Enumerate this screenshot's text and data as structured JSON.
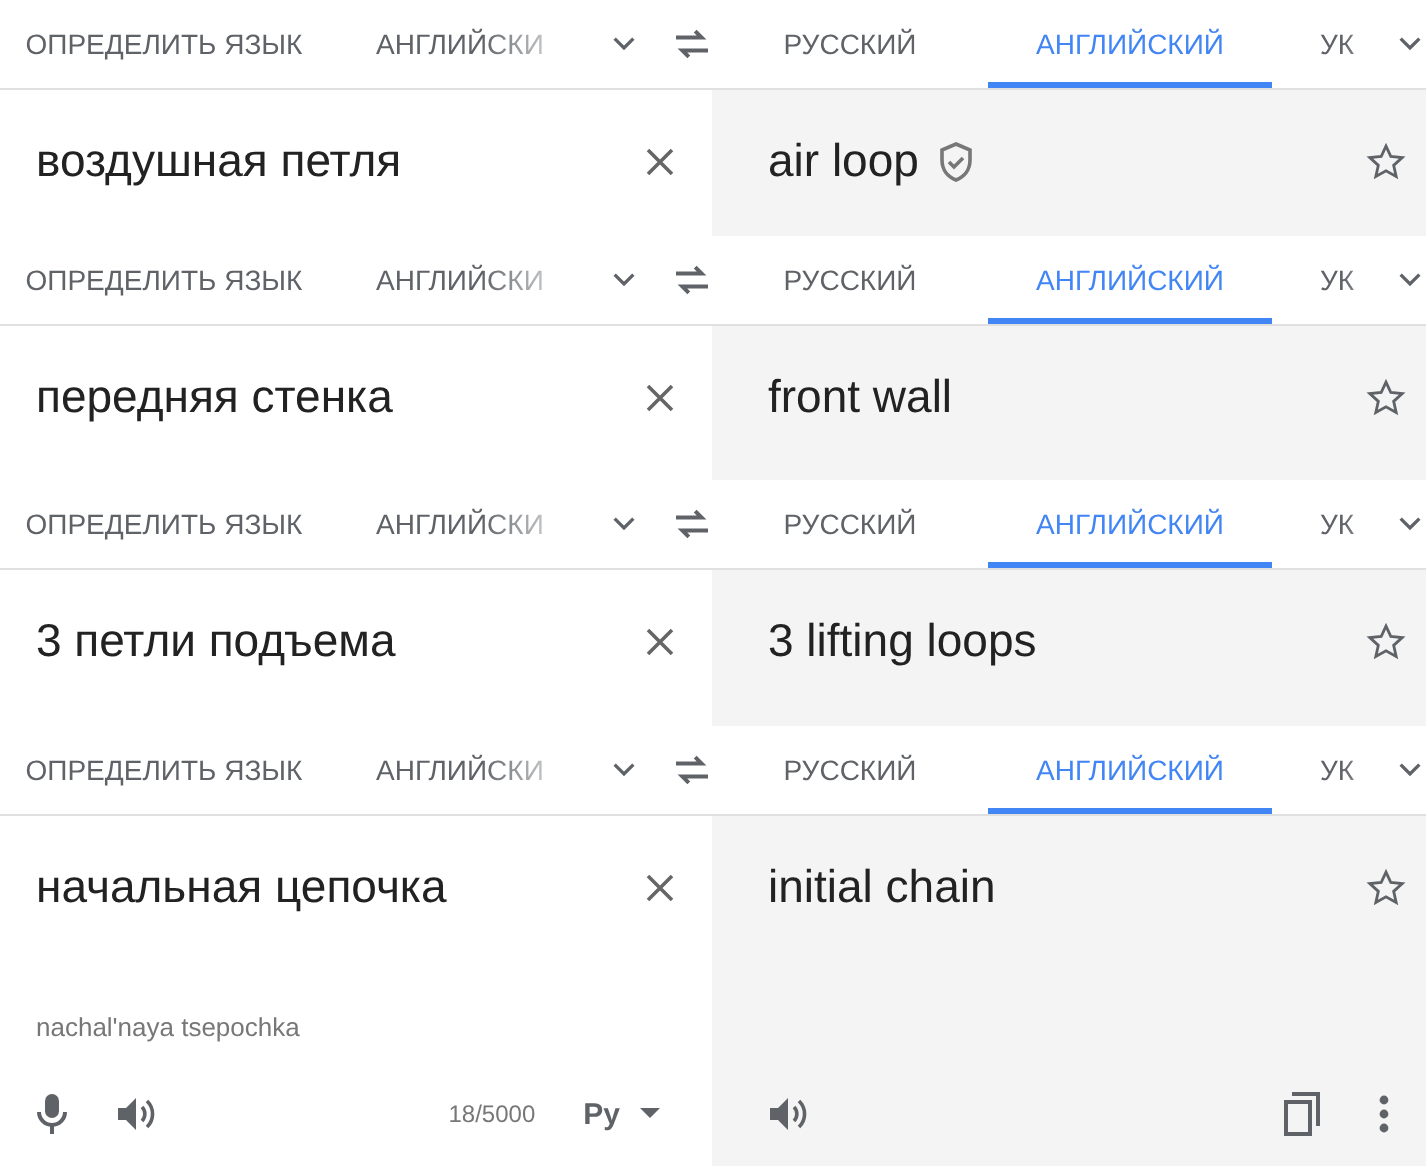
{
  "panels": [
    {
      "source_tabs": [
        {
          "label": "ОПРЕДЕЛИТЬ ЯЗЫК",
          "selected": false,
          "cut": false
        },
        {
          "label": "АНГЛИЙСКИ",
          "selected": false,
          "cut": true
        }
      ],
      "target_tabs": [
        {
          "label": "РУССКИЙ",
          "selected": false,
          "cut": false
        },
        {
          "label": "АНГЛИЙСКИЙ",
          "selected": true,
          "cut": false
        },
        {
          "label": "УК",
          "selected": false,
          "cut": true
        }
      ],
      "source_text": "воздушная петля",
      "translation": "air loop",
      "verified": true
    },
    {
      "source_tabs": [
        {
          "label": "ОПРЕДЕЛИТЬ ЯЗЫК",
          "selected": false,
          "cut": false
        },
        {
          "label": "АНГЛИЙСКИ",
          "selected": false,
          "cut": true
        }
      ],
      "target_tabs": [
        {
          "label": "РУССКИЙ",
          "selected": false,
          "cut": false
        },
        {
          "label": "АНГЛИЙСКИЙ",
          "selected": true,
          "cut": false
        },
        {
          "label": "УК",
          "selected": false,
          "cut": true
        }
      ],
      "source_text": "передняя стенка",
      "translation": "front wall",
      "verified": false
    },
    {
      "source_tabs": [
        {
          "label": "ОПРЕДЕЛИТЬ ЯЗЫК",
          "selected": false,
          "cut": false
        },
        {
          "label": "АНГЛИЙСКИ",
          "selected": false,
          "cut": true
        }
      ],
      "target_tabs": [
        {
          "label": "РУССКИЙ",
          "selected": false,
          "cut": false
        },
        {
          "label": "АНГЛИЙСКИЙ",
          "selected": true,
          "cut": false
        },
        {
          "label": "УК",
          "selected": false,
          "cut": true
        }
      ],
      "source_text": "3 петли подъема",
      "translation": "3 lifting loops",
      "verified": false
    },
    {
      "source_tabs": [
        {
          "label": "ОПРЕДЕЛИТЬ ЯЗЫК",
          "selected": false,
          "cut": false
        },
        {
          "label": "АНГЛИЙСКИ",
          "selected": false,
          "cut": true
        }
      ],
      "target_tabs": [
        {
          "label": "РУССКИЙ",
          "selected": false,
          "cut": false
        },
        {
          "label": "АНГЛИЙСКИЙ",
          "selected": true,
          "cut": false
        },
        {
          "label": "УК",
          "selected": false,
          "cut": true
        }
      ],
      "source_text": "начальная цепочка",
      "translation": "initial chain",
      "verified": false,
      "transliteration": "nachal'naya tsepochka",
      "char_count": "18/5000",
      "input_tool": "Ру"
    }
  ]
}
